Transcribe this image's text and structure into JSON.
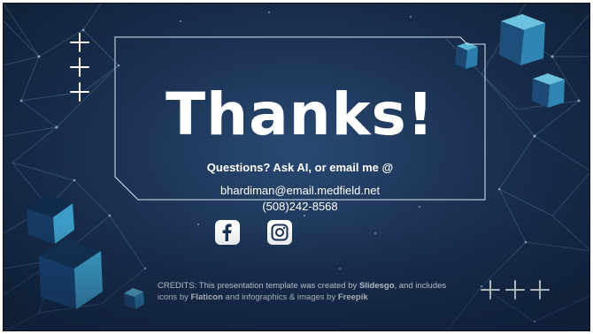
{
  "slide": {
    "title": "Thanks!",
    "questions": "Questions? Ask AI, or email me @",
    "email": "bhardiman@email.medfield.net",
    "phone": "(508)242-8568"
  },
  "credits": {
    "part1": "CREDITS: This presentation template was created by ",
    "slidesgo": "Slidesgo",
    "part2": ", and includes icons by ",
    "flaticon": "Flaticon",
    "part3": " and infographics & images by ",
    "freepik": "Freepik"
  },
  "icons": {
    "facebook": "facebook-icon",
    "instagram": "instagram-icon",
    "plus": "plus-icon"
  },
  "colors": {
    "background": "#1a3152",
    "accent_cube": "#4aa6c8",
    "text": "#ffffff"
  }
}
